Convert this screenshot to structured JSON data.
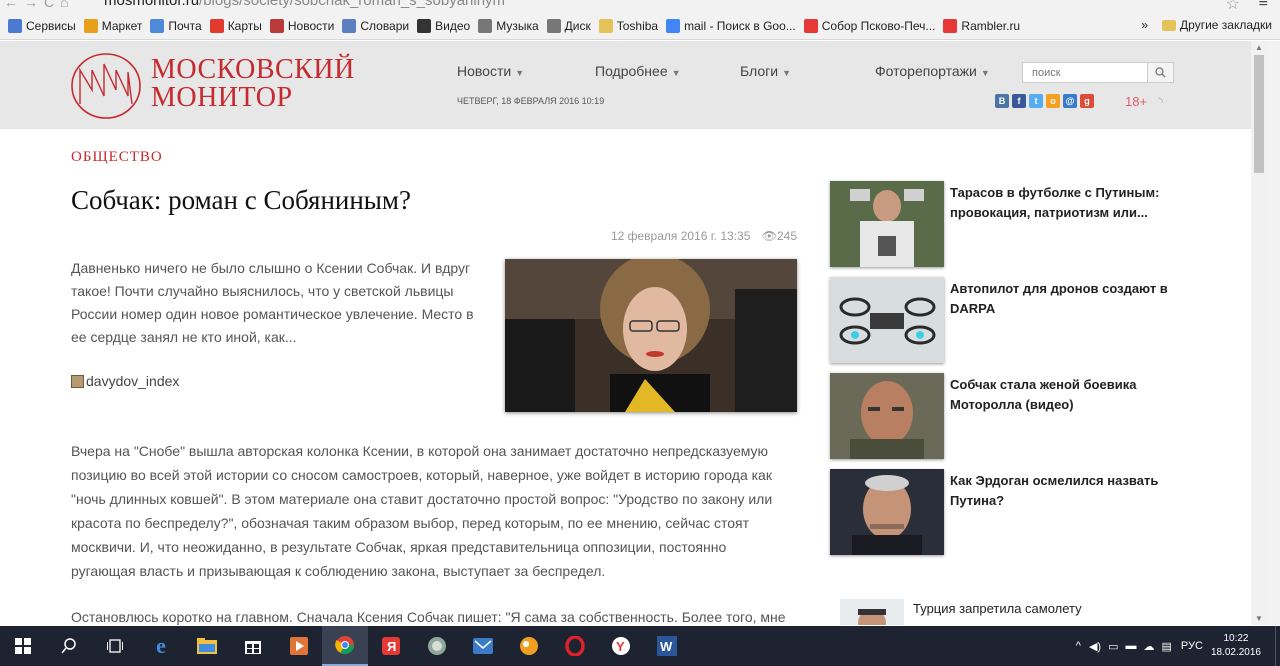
{
  "browser": {
    "url_domain": "mosmonitor.ru",
    "url_path": "/blogs/society/sobchak_roman_s_sobyaninym",
    "bookmarks": [
      {
        "label": "Сервисы",
        "icon": "apps-icon",
        "color": "#4a7bd0"
      },
      {
        "label": "Маркет",
        "icon": "market-icon",
        "color": "#e8a01b"
      },
      {
        "label": "Почта",
        "icon": "mail-icon",
        "color": "#4d8bd8"
      },
      {
        "label": "Карты",
        "icon": "map-pin-icon",
        "color": "#e23b2e"
      },
      {
        "label": "Новости",
        "icon": "news-icon",
        "color": "#b83a3a"
      },
      {
        "label": "Словари",
        "icon": "dictionary-icon",
        "color": "#5b7fbf"
      },
      {
        "label": "Видео",
        "icon": "video-icon",
        "color": "#333333"
      },
      {
        "label": "Музыка",
        "icon": "music-icon",
        "color": "#777777"
      },
      {
        "label": "Диск",
        "icon": "disk-icon",
        "color": "#777777"
      },
      {
        "label": "Toshiba",
        "icon": "folder-icon",
        "color": "#e6c25a"
      },
      {
        "label": "mail - Поиск в Goo...",
        "icon": "google-icon",
        "color": "#4285f4"
      },
      {
        "label": "Собор Псково-Печ...",
        "icon": "yandex-icon",
        "color": "#e53935"
      },
      {
        "label": "Rambler.ru",
        "icon": "yandex-icon",
        "color": "#e53935"
      }
    ],
    "bookmarks_more": "»",
    "other_bookmarks": "Другие закладки"
  },
  "site": {
    "logo_line1": "МОСКОВСКИЙ",
    "logo_line2": "МОНИТОР",
    "nav": [
      "Новости",
      "Подробнее",
      "Блоги",
      "Фоторепортажи"
    ],
    "date": "ЧЕТВЕРГ, 18 ФЕВРАЛЯ 2016 10:19",
    "search_placeholder": "поиск",
    "age_rating": "18+",
    "brand_color": "#c62a2f"
  },
  "article": {
    "section": "ОБЩЕСТВО",
    "title": "Собчак: роман с Собяниным?",
    "published": "12 февраля 2016 г. 13:35",
    "views": "245",
    "lead": "Давненько ничего не было слышно о Ксении Собчак. И вдруг такое! Почти случайно выяснилось, что у светской львицы России номер один новое романтическое увлечение. Место в ее сердце занял не кто иной, как...",
    "author": "davydov_index",
    "paragraph1": "Вчера на \"Снобе\" вышла авторская колонка Ксении, в которой она занимает достаточно непредсказуемую позицию во всей этой истории со сносом самостроев, который, наверное, уже войдет в историю города как \"ночь длинных ковшей\". В этом материале она ставит достаточно простой вопрос: \"Уродство по закону или красота по беспределу?\", обозначая таким образом выбор, перед которым, по ее мнению, сейчас стоят москвичи. И, что неожиданно, в результате Собчак, яркая представительница оппозиции, постоянно ругающая власть и призывающая к соблюдению закона, выступает за беспредел.",
    "paragraph2": "Остановлюсь коротко на главном. Сначала Ксения Собчак пишет: \"Я сама за собственность. Более того, мне"
  },
  "sidebar": [
    {
      "title": "Тарасов в футболке с Путиным: провокация, патриотизм или..."
    },
    {
      "title": "Автопилот для дронов создают в DARPA"
    },
    {
      "title": "Собчак стала женой боевика Моторолла (видео)"
    },
    {
      "title": "Как Эрдоган осмелился назвать Путина?"
    }
  ],
  "sidebar_extra": {
    "title": "Турция запретила самолету"
  },
  "taskbar": {
    "language": "РУС",
    "time": "10:22",
    "date": "18.02.2016"
  }
}
